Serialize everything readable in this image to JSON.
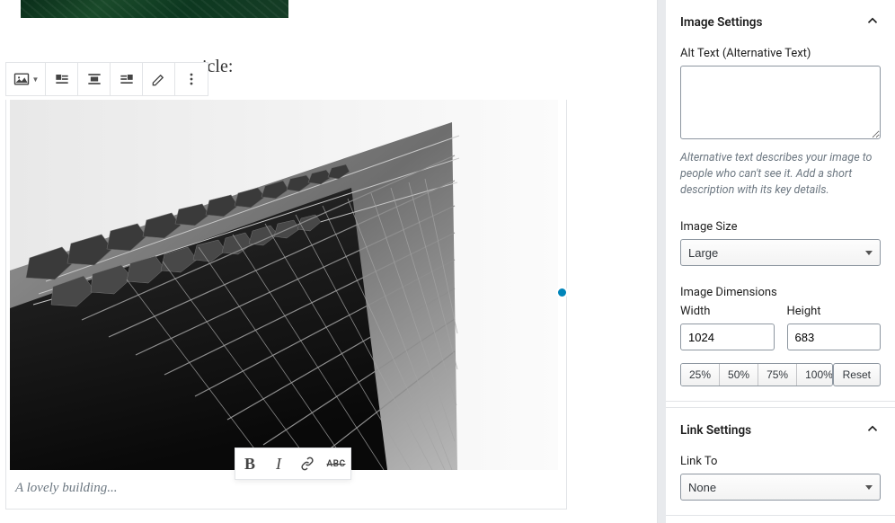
{
  "editor": {
    "partial_text": "icle:",
    "caption": "A lovely building..."
  },
  "toolbar": {
    "block_type": "image",
    "align_left": "align-left",
    "align_center": "align-center",
    "align_right": "align-right",
    "edit": "edit",
    "more": "more"
  },
  "float_toolbar": {
    "bold": "B",
    "italic": "I",
    "link": "link",
    "strike": "ABC"
  },
  "sidebar": {
    "image_settings": {
      "title": "Image Settings",
      "alt_label": "Alt Text (Alternative Text)",
      "alt_value": "",
      "alt_help": "Alternative text describes your image to people who can't see it. Add a short description with its key details.",
      "size_label": "Image Size",
      "size_value": "Large",
      "dimensions_label": "Image Dimensions",
      "width_label": "Width",
      "width_value": "1024",
      "height_label": "Height",
      "height_value": "683",
      "pct25": "25%",
      "pct50": "50%",
      "pct75": "75%",
      "pct100": "100%",
      "reset": "Reset"
    },
    "link_settings": {
      "title": "Link Settings",
      "link_to_label": "Link To",
      "link_to_value": "None"
    }
  }
}
